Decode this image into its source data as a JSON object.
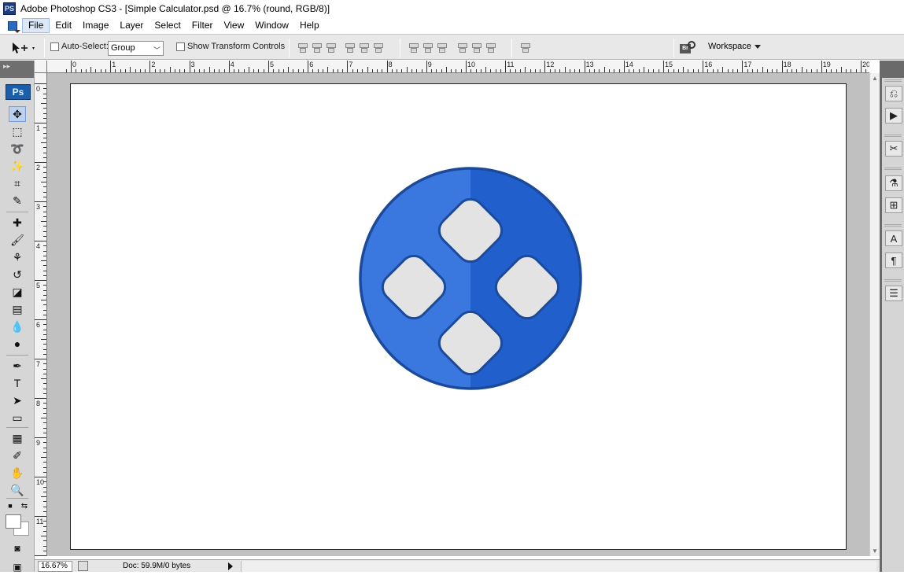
{
  "window": {
    "app_icon": "PS",
    "title": "Adobe Photoshop CS3 - [Simple Calculator.psd @ 16.7% (round, RGB/8)]"
  },
  "menu": {
    "items": [
      "File",
      "Edit",
      "Image",
      "Layer",
      "Select",
      "Filter",
      "View",
      "Window",
      "Help"
    ],
    "active": "File"
  },
  "options": {
    "auto_select_label": "Auto-Select:",
    "auto_select_value": "Group",
    "show_transform_label": "Show Transform Controls",
    "workspace_label": "Workspace",
    "bridge_icon": "Br"
  },
  "toolbox": {
    "badge": "Ps",
    "tools": [
      {
        "name": "move-tool",
        "glyph": "✥",
        "active": true
      },
      {
        "name": "marquee-tool",
        "glyph": "⬚"
      },
      {
        "name": "lasso-tool",
        "glyph": "➰"
      },
      {
        "name": "magic-wand-tool",
        "glyph": "✨"
      },
      {
        "name": "crop-tool",
        "glyph": "⌗"
      },
      {
        "name": "slice-tool",
        "glyph": "✎"
      },
      {
        "name": "healing-brush-tool",
        "glyph": "✚"
      },
      {
        "name": "brush-tool",
        "glyph": "🖌"
      },
      {
        "name": "clone-stamp-tool",
        "glyph": "⚘"
      },
      {
        "name": "history-brush-tool",
        "glyph": "↺"
      },
      {
        "name": "eraser-tool",
        "glyph": "◪"
      },
      {
        "name": "gradient-tool",
        "glyph": "▤"
      },
      {
        "name": "blur-tool",
        "glyph": "💧"
      },
      {
        "name": "dodge-tool",
        "glyph": "●"
      },
      {
        "name": "pen-tool",
        "glyph": "✒"
      },
      {
        "name": "type-tool",
        "glyph": "T"
      },
      {
        "name": "path-selection-tool",
        "glyph": "➤"
      },
      {
        "name": "shape-tool",
        "glyph": "▭"
      },
      {
        "name": "notes-tool",
        "glyph": "▦"
      },
      {
        "name": "eyedropper-tool",
        "glyph": "✐"
      },
      {
        "name": "hand-tool",
        "glyph": "✋"
      },
      {
        "name": "zoom-tool",
        "glyph": "🔍"
      }
    ]
  },
  "rulers": {
    "top_labels": [
      "0",
      "1",
      "2",
      "3",
      "4",
      "5",
      "6",
      "7",
      "8",
      "9",
      "10",
      "11",
      "12",
      "13",
      "14",
      "15",
      "16",
      "17",
      "18",
      "19",
      "20"
    ],
    "left_labels": [
      "0",
      "1",
      "2",
      "3",
      "4",
      "5",
      "6",
      "7",
      "8",
      "9",
      "10",
      "11"
    ]
  },
  "canvas": {
    "artwork": "circular calculator-style icon with four rounded-square keys",
    "colors": {
      "circle_left": "#3a78e0",
      "circle_right": "#2160cc",
      "circle_border": "#1c4a9b",
      "key_fill": "#e3e3e3",
      "key_border": "#1c4a9b"
    }
  },
  "dock": {
    "buttons": [
      {
        "name": "history-panel-icon",
        "glyph": "⎌"
      },
      {
        "name": "actions-panel-icon",
        "glyph": "▶"
      },
      {
        "name": "tool-presets-icon",
        "glyph": "✂"
      },
      {
        "name": "brushes-panel-icon",
        "glyph": "⚗"
      },
      {
        "name": "clone-source-icon",
        "glyph": "⊞"
      },
      {
        "name": "character-panel-icon",
        "glyph": "A"
      },
      {
        "name": "paragraph-panel-icon",
        "glyph": "¶"
      },
      {
        "name": "layer-comps-icon",
        "glyph": "☰"
      }
    ]
  },
  "status": {
    "zoom": "16.67%",
    "doc_info": "Doc: 59.9M/0 bytes"
  }
}
